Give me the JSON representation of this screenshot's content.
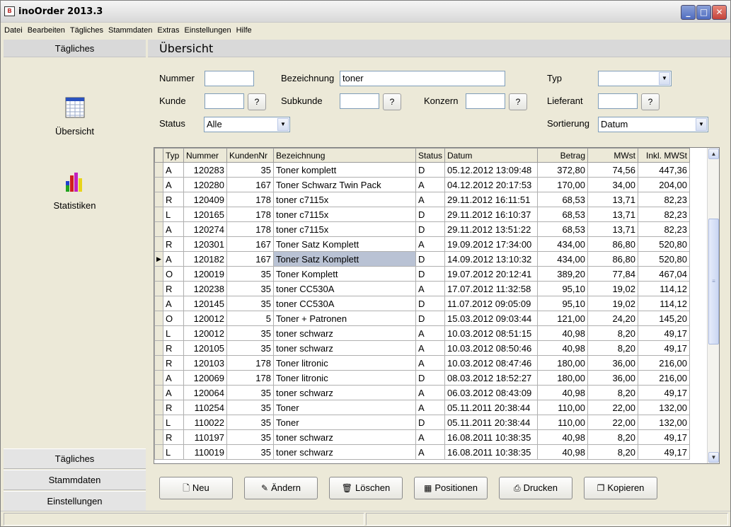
{
  "window": {
    "title": "inoOrder 2013.3",
    "app_icon_text": "B"
  },
  "menu": [
    "Datei",
    "Bearbeiten",
    "Tägliches",
    "Stammdaten",
    "Extras",
    "Einstellungen",
    "Hilfe"
  ],
  "sidebar": {
    "header": "Tägliches",
    "entries": [
      {
        "label": "Übersicht",
        "icon": "calendar-grid-icon"
      },
      {
        "label": "Statistiken",
        "icon": "bar-chart-icon"
      }
    ],
    "nav": [
      "Tägliches",
      "Stammdaten",
      "Einstellungen"
    ]
  },
  "main": {
    "title": "Übersicht"
  },
  "form": {
    "nummer_label": "Nummer",
    "nummer_value": "",
    "bezeichnung_label": "Bezeichnung",
    "bezeichnung_value": "toner",
    "typ_label": "Typ",
    "typ_value": "",
    "kunde_label": "Kunde",
    "kunde_value": "",
    "subkunde_label": "Subkunde",
    "subkunde_value": "",
    "konzern_label": "Konzern",
    "konzern_value": "",
    "lieferant_label": "Lieferant",
    "lieferant_value": "",
    "status_label": "Status",
    "status_value": "Alle",
    "sortierung_label": "Sortierung",
    "sortierung_value": "Datum",
    "lookup_label": "?"
  },
  "grid": {
    "columns": [
      "Typ",
      "Nummer",
      "KundenNr",
      "Bezeichnung",
      "Status",
      "Datum",
      "Betrag",
      "MWst",
      "Inkl. MWSt"
    ],
    "selected_row": 6,
    "rows": [
      [
        "A",
        "120283",
        "35",
        "Toner komplett",
        "D",
        "05.12.2012 13:09:48",
        "372,80",
        "74,56",
        "447,36"
      ],
      [
        "A",
        "120280",
        "167",
        "Toner Schwarz Twin Pack",
        "A",
        "04.12.2012 20:17:53",
        "170,00",
        "34,00",
        "204,00"
      ],
      [
        "R",
        "120409",
        "178",
        "toner c7115x",
        "A",
        "29.11.2012 16:11:51",
        "68,53",
        "13,71",
        "82,23"
      ],
      [
        "L",
        "120165",
        "178",
        "toner c7115x",
        "D",
        "29.11.2012 16:10:37",
        "68,53",
        "13,71",
        "82,23"
      ],
      [
        "A",
        "120274",
        "178",
        "toner c7115x",
        "D",
        "29.11.2012 13:51:22",
        "68,53",
        "13,71",
        "82,23"
      ],
      [
        "R",
        "120301",
        "167",
        "Toner Satz Komplett",
        "A",
        "19.09.2012 17:34:00",
        "434,00",
        "86,80",
        "520,80"
      ],
      [
        "A",
        "120182",
        "167",
        "Toner Satz Komplett",
        "D",
        "14.09.2012 13:10:32",
        "434,00",
        "86,80",
        "520,80"
      ],
      [
        "O",
        "120019",
        "35",
        "Toner Komplett",
        "D",
        "19.07.2012 20:12:41",
        "389,20",
        "77,84",
        "467,04"
      ],
      [
        "R",
        "120238",
        "35",
        "toner CC530A",
        "A",
        "17.07.2012 11:32:58",
        "95,10",
        "19,02",
        "114,12"
      ],
      [
        "A",
        "120145",
        "35",
        "toner CC530A",
        "D",
        "11.07.2012 09:05:09",
        "95,10",
        "19,02",
        "114,12"
      ],
      [
        "O",
        "120012",
        "5",
        "Toner + Patronen",
        "D",
        "15.03.2012 09:03:44",
        "121,00",
        "24,20",
        "145,20"
      ],
      [
        "L",
        "120012",
        "35",
        "toner schwarz",
        "A",
        "10.03.2012 08:51:15",
        "40,98",
        "8,20",
        "49,17"
      ],
      [
        "R",
        "120105",
        "35",
        "toner schwarz",
        "A",
        "10.03.2012 08:50:46",
        "40,98",
        "8,20",
        "49,17"
      ],
      [
        "R",
        "120103",
        "178",
        "Toner litronic",
        "A",
        "10.03.2012 08:47:46",
        "180,00",
        "36,00",
        "216,00"
      ],
      [
        "A",
        "120069",
        "178",
        "Toner litronic",
        "D",
        "08.03.2012 18:52:27",
        "180,00",
        "36,00",
        "216,00"
      ],
      [
        "A",
        "120064",
        "35",
        "toner schwarz",
        "A",
        "06.03.2012 08:43:09",
        "40,98",
        "8,20",
        "49,17"
      ],
      [
        "R",
        "110254",
        "35",
        "Toner",
        "A",
        "05.11.2011 20:38:44",
        "110,00",
        "22,00",
        "132,00"
      ],
      [
        "L",
        "110022",
        "35",
        "Toner",
        "D",
        "05.11.2011 20:38:44",
        "110,00",
        "22,00",
        "132,00"
      ],
      [
        "R",
        "110197",
        "35",
        "toner schwarz",
        "A",
        "16.08.2011 10:38:35",
        "40,98",
        "8,20",
        "49,17"
      ],
      [
        "L",
        "110019",
        "35",
        "toner schwarz",
        "A",
        "16.08.2011 10:38:35",
        "40,98",
        "8,20",
        "49,17"
      ]
    ]
  },
  "actions": [
    {
      "label": "Neu",
      "icon": "new-document-icon",
      "glyph": "🗋"
    },
    {
      "label": "Ändern",
      "icon": "edit-document-icon",
      "glyph": "✎"
    },
    {
      "label": "Löschen",
      "icon": "trash-icon",
      "glyph": "🗑"
    },
    {
      "label": "Positionen",
      "icon": "table-icon",
      "glyph": "▦"
    },
    {
      "label": "Drucken",
      "icon": "printer-icon",
      "glyph": "⎙"
    },
    {
      "label": "Kopieren",
      "icon": "copy-icon",
      "glyph": "❐"
    }
  ]
}
